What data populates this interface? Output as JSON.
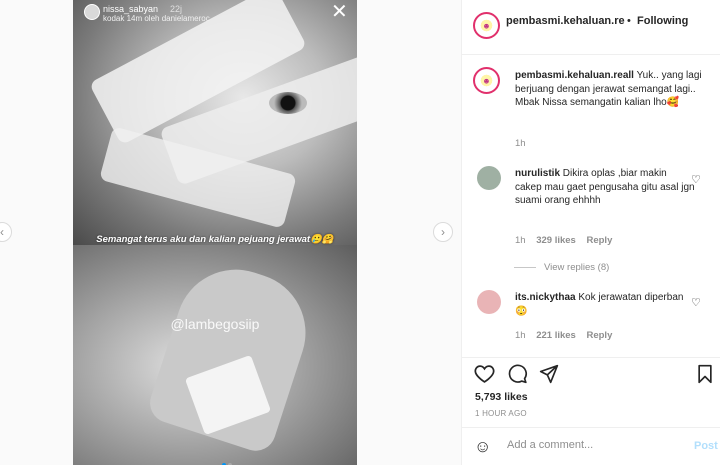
{
  "story": {
    "username": "nissa_sabyan",
    "time": "22j",
    "tag_line": "kodak 14m oleh danielameroc",
    "caption": "Semangat terus aku dan kalian pejuang jerawat🥲🤗",
    "watermark": "@lambegosiip"
  },
  "post": {
    "account": "pembasmi.kehaluan.re",
    "separator": "•",
    "follow_label": "Following",
    "caption_user": "pembasmi.kehaluan.reall",
    "caption_text": "Yuk.. yang lagi berjuang dengan jerawat semangat lagi.. Mbak Nissa semangatin kalian lho🥰",
    "caption_time": "1h"
  },
  "comments": [
    {
      "user": "nurulistik",
      "text": "Dikira oplas ,biar makin cakep mau gaet pengusaha gitu asal jgn suami orang ehhhh",
      "time": "1h",
      "likes": "329 likes",
      "reply": "Reply",
      "avatar_color": "#9fb0a3"
    },
    {
      "user": "its.nickythaa",
      "text": "Kok jerawatan diperban 😳",
      "time": "1h",
      "likes": "221 likes",
      "reply": "Reply",
      "avatar_color": "#e9b4b6"
    }
  ],
  "view_replies": "View replies (8)",
  "likes_count": "5,793 likes",
  "posted_ago": "1 HOUR AGO",
  "add_comment": {
    "placeholder": "Add a comment...",
    "post_label": "Post"
  },
  "icons": {
    "like": "heart-icon",
    "comment": "comment-icon",
    "share": "share-icon",
    "save": "bookmark-icon",
    "emoji": "smiley-icon",
    "close": "close-icon"
  },
  "colors": {
    "link_blue": "#0095f6",
    "post_disabled": "#b2dffc",
    "story_ring": "#e1306c"
  }
}
